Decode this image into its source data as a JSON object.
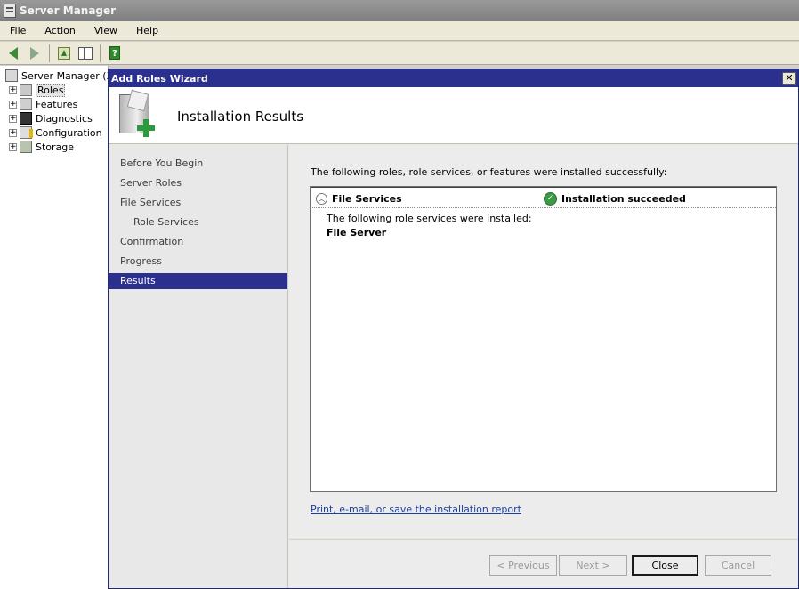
{
  "main_window": {
    "title": "Server Manager",
    "menu": [
      "File",
      "Action",
      "View",
      "Help"
    ]
  },
  "tree": {
    "root": "Server Manager (XE",
    "items": [
      "Roles",
      "Features",
      "Diagnostics",
      "Configuration",
      "Storage"
    ]
  },
  "wizard": {
    "title": "Add Roles Wizard",
    "close_glyph": "✕",
    "heading": "Installation Results",
    "steps": [
      "Before You Begin",
      "Server Roles",
      "File Services",
      "Role Services",
      "Confirmation",
      "Progress",
      "Results"
    ],
    "active_step": "Results",
    "intro": "The following roles, role services, or features were installed successfully:",
    "result": {
      "role": "File Services",
      "status": "Installation succeeded",
      "description": "The following role services were installed:",
      "item": "File Server"
    },
    "report_link": "Print, e-mail, or save the installation report",
    "buttons": {
      "previous": "< Previous",
      "next": "Next >",
      "close": "Close",
      "cancel": "Cancel"
    }
  },
  "colors": {
    "wizard_title_bg": "#2b2f8e",
    "active_step_bg": "#2b2f8e",
    "success_green": "#3a9a45",
    "link": "#1c3f9e"
  }
}
